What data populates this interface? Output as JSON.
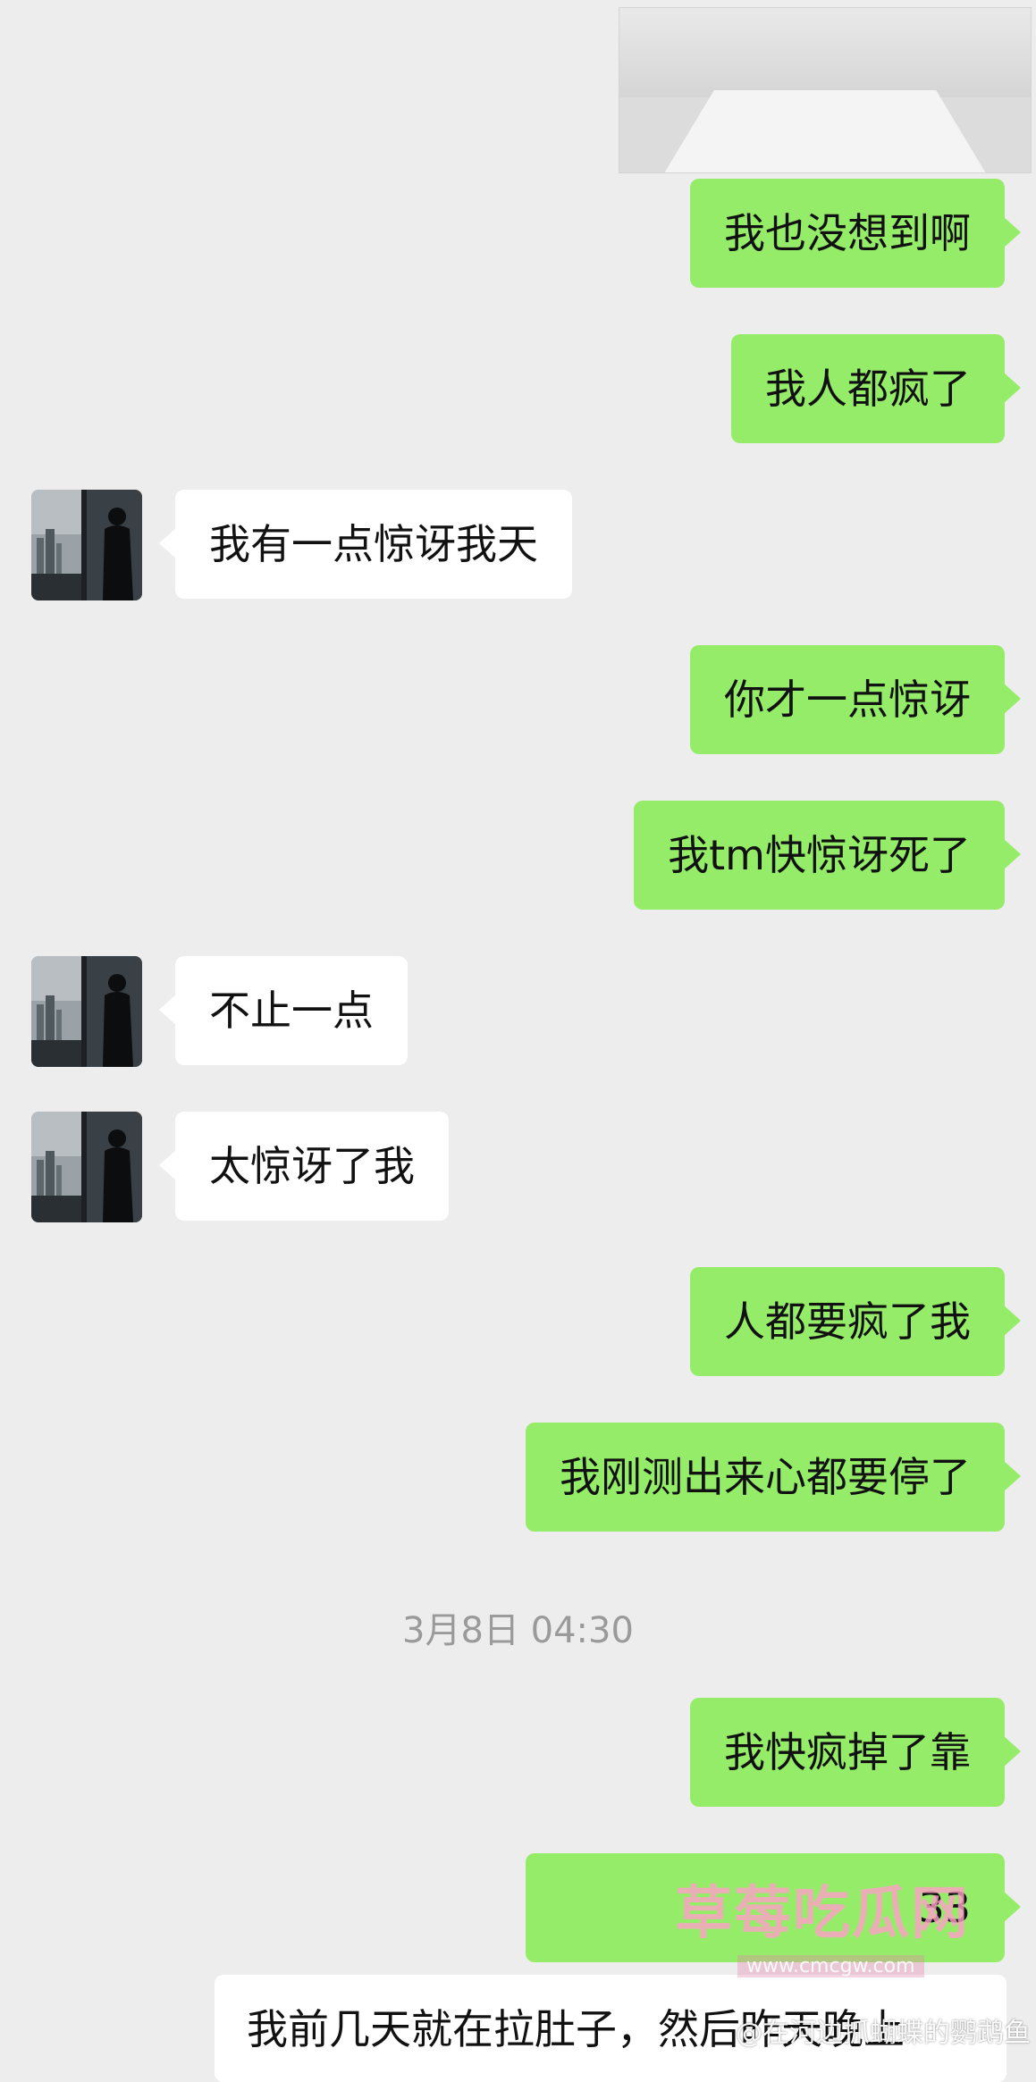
{
  "colors": {
    "background": "#ededed",
    "outgoing_bubble": "#95ec69",
    "incoming_bubble": "#ffffff",
    "timestamp": "#9a9a9a"
  },
  "chat": {
    "messages": [
      {
        "dir": "out",
        "text": "我也没想到啊"
      },
      {
        "dir": "out",
        "text": "我人都疯了"
      },
      {
        "dir": "in",
        "text": "我有一点惊讶我天"
      },
      {
        "dir": "out",
        "text": "你才一点惊讶"
      },
      {
        "dir": "out",
        "text": "我tm快惊讶死了"
      },
      {
        "dir": "in",
        "text": "不止一点"
      },
      {
        "dir": "in",
        "text": "太惊讶了我"
      },
      {
        "dir": "out",
        "text": "人都要疯了我"
      },
      {
        "dir": "out",
        "text": "我刚测出来心都要停了"
      },
      {
        "dir": "out",
        "text": "我快疯掉了靠"
      },
      {
        "dir": "out",
        "text": "33"
      }
    ],
    "timestamp": "3月8日 04:30",
    "last_incoming_partial": "我前几天就在拉肚子，然后昨天晚上"
  },
  "watermark": {
    "main": "草莓吃瓜网",
    "url": "www.cmcgw.com",
    "weibo": "@在河边抓蝴蝶的鹦鹉鱼"
  }
}
